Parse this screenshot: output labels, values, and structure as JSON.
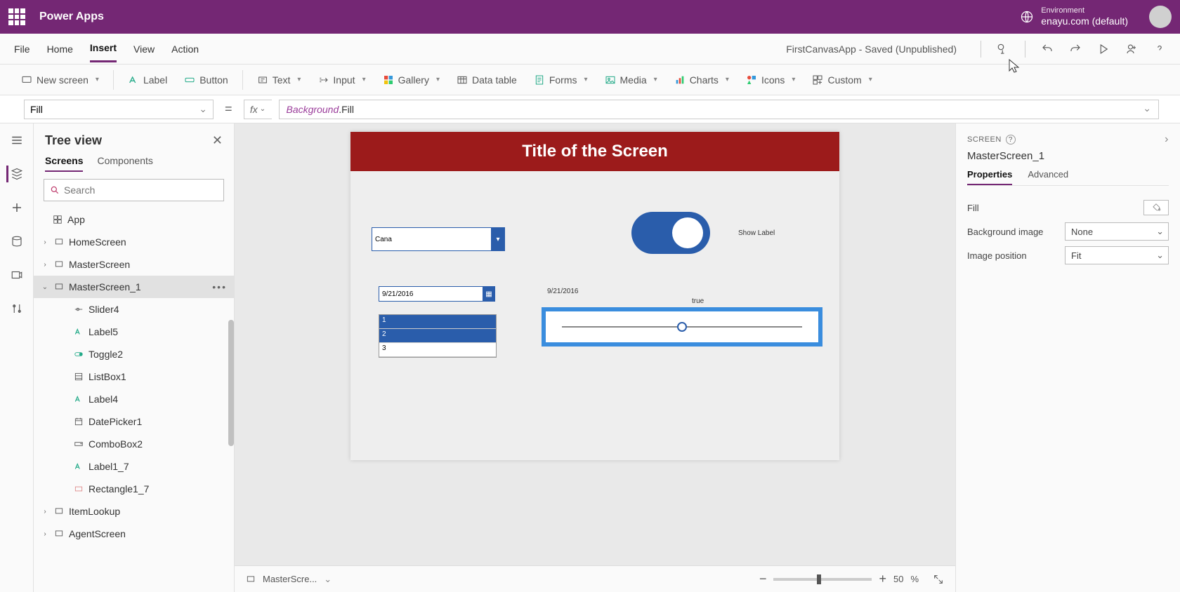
{
  "header": {
    "appTitle": "Power Apps",
    "envLabel": "Environment",
    "envName": "enayu.com (default)"
  },
  "menu": {
    "items": [
      "File",
      "Home",
      "Insert",
      "View",
      "Action"
    ],
    "active": "Insert",
    "saveStatus": "FirstCanvasApp - Saved (Unpublished)"
  },
  "ribbon": {
    "newScreen": "New screen",
    "label": "Label",
    "button": "Button",
    "text": "Text",
    "input": "Input",
    "gallery": "Gallery",
    "dataTable": "Data table",
    "forms": "Forms",
    "media": "Media",
    "charts": "Charts",
    "icons": "Icons",
    "custom": "Custom"
  },
  "formula": {
    "property": "Fill",
    "fx": "fx",
    "exprIdent": "Background",
    "exprProp": ".Fill"
  },
  "tree": {
    "title": "Tree view",
    "tabs": {
      "screens": "Screens",
      "components": "Components"
    },
    "searchPlaceholder": "Search",
    "app": "App",
    "homeScreen": "HomeScreen",
    "masterScreen": "MasterScreen",
    "masterScreen1": "MasterScreen_1",
    "slider4": "Slider4",
    "label5": "Label5",
    "toggle2": "Toggle2",
    "listbox1": "ListBox1",
    "label4": "Label4",
    "datepicker1": "DatePicker1",
    "combobox2": "ComboBox2",
    "label17": "Label1_7",
    "rectangle17": "Rectangle1_7",
    "itemLookup": "ItemLookup",
    "agentScreen": "AgentScreen"
  },
  "canvas": {
    "title": "Title of the Screen",
    "comboValue": "Cana",
    "showLabel": "Show Label",
    "dateValue": "9/21/2016",
    "dateLabel": "9/21/2016",
    "trueLabel": "true",
    "list": [
      "1",
      "2",
      "3"
    ]
  },
  "status": {
    "screenDrop": "MasterScre...",
    "zoomPct": "50",
    "zoomUnit": "%"
  },
  "props": {
    "sectionLabel": "SCREEN",
    "screenName": "MasterScreen_1",
    "tabs": {
      "properties": "Properties",
      "advanced": "Advanced"
    },
    "fillLabel": "Fill",
    "bgImageLabel": "Background image",
    "bgImageValue": "None",
    "imgPosLabel": "Image position",
    "imgPosValue": "Fit"
  }
}
